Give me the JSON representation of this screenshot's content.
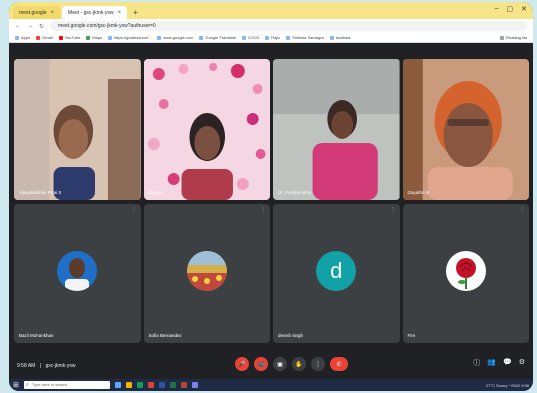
{
  "browser": {
    "tabs": [
      {
        "label": "meet.google",
        "active": false
      },
      {
        "label": "Meet - gsc-jkmk-ysw",
        "active": true
      }
    ],
    "newtab_glyph": "+",
    "window_controls": [
      "–",
      "▢",
      "✕"
    ],
    "url": "meet.google.com/gsc-jkmk-ysw?authuser=0",
    "nav_glyphs": [
      "←",
      "→",
      "↻"
    ],
    "bookmarks": [
      "Apps",
      "Gmail",
      "YouTube",
      "Maps",
      "https://gradeschool...",
      "www.google.com",
      "Google Translate",
      "CVCD",
      "Rajiv",
      "Shiksha Samagra",
      "Aadhaar"
    ],
    "bookmarks_right": "Reading list"
  },
  "participants": [
    {
      "name": "Vijayalakshmi Pillai S",
      "type": "video"
    },
    {
      "name": "Mayuri",
      "type": "video"
    },
    {
      "name": "Dr. Pushpa Mary",
      "type": "video"
    },
    {
      "name": "Gayathri N",
      "type": "video"
    },
    {
      "name": "Bazil Mohankhan",
      "type": "photo"
    },
    {
      "name": "Sofia Bernandez",
      "type": "photo"
    },
    {
      "name": "devish singh",
      "type": "letter",
      "letter": "d"
    },
    {
      "name": "Fire",
      "type": "photo"
    }
  ],
  "tile_more_glyph": "⋮",
  "meetbar": {
    "time": "9:58 AM",
    "separator": "|",
    "meeting_code": "gsc-jkmk-ysw",
    "controls": [
      "🎤",
      "📹",
      "▣",
      "✋",
      "⋮"
    ],
    "end_call_glyph": "✆",
    "right_controls": [
      "ⓘ",
      "👥",
      "💬",
      "⚙"
    ]
  },
  "taskbar": {
    "start_glyph": "⊞",
    "search_placeholder": "Type here to search",
    "tray_text": "27°C  Sunny  ^  ENG  9:58"
  },
  "colors": {
    "background": "#cfe9ef",
    "meet_bg": "#202124",
    "tile_bg": "#3c4043",
    "tab_strip": "#f6e489",
    "end_call": "#ea4335",
    "avatar_letter_bg": "#13a1a8"
  }
}
